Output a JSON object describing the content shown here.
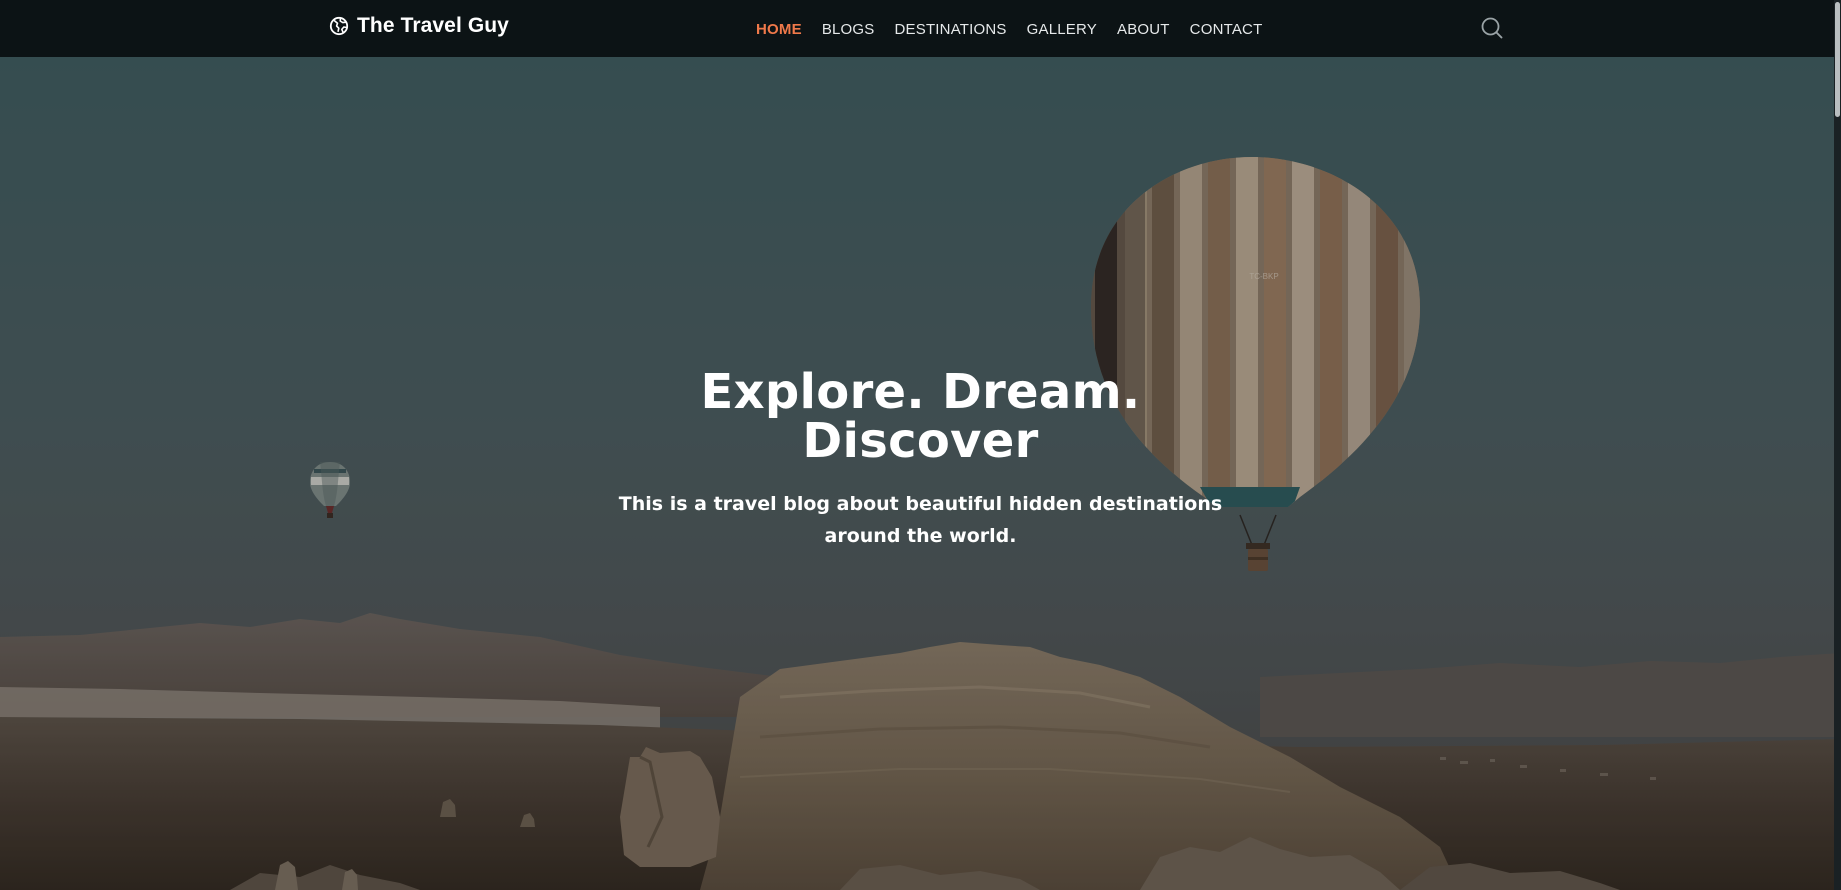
{
  "brand": {
    "name": "The Travel Guy",
    "icon": "globe-icon"
  },
  "nav": {
    "items": [
      {
        "label": "HOME",
        "active": true
      },
      {
        "label": "BLOGS",
        "active": false
      },
      {
        "label": "DESTINATIONS",
        "active": false
      },
      {
        "label": "GALLERY",
        "active": false
      },
      {
        "label": "ABOUT",
        "active": false
      },
      {
        "label": "CONTACT",
        "active": false
      }
    ],
    "search_icon": "search-icon"
  },
  "hero": {
    "title": "Explore. Dream. Discover",
    "subtitle": "This is a travel blog about beautiful hidden destinations around the world.",
    "balloon_label": "TC-BKP"
  },
  "colors": {
    "nav_bg": "#0c1315",
    "accent": "#f0794a",
    "nav_text": "#e6e9ea",
    "sky_top": "#3f5b5d",
    "sky_bottom": "#4b5356"
  }
}
